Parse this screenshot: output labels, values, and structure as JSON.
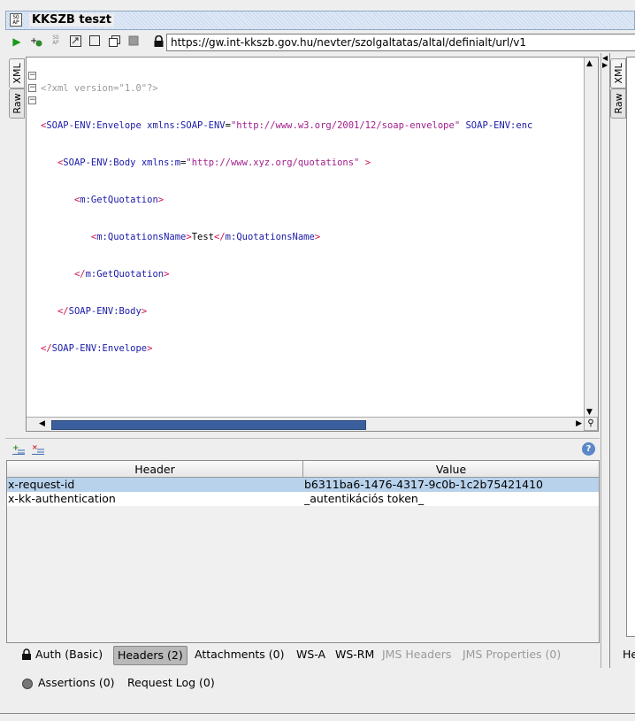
{
  "window": {
    "title": "KKSZB teszt",
    "logo_text": "SO AP"
  },
  "toolbar": {
    "url": "https://gw.int-kkszb.gov.hu/nevter/szolgaltatas/altal/definialt/url/v1",
    "icons": [
      "run-icon",
      "add-endpoint-icon",
      "soap-icon",
      "format-icon",
      "split-view-icon",
      "tab-view-icon",
      "stop-icon",
      "lock-icon"
    ]
  },
  "side_tabs": {
    "xml": "XML",
    "raw": "Raw"
  },
  "editor": {
    "pi": "<?xml version=\"1.0\"?>",
    "lines": {
      "l2_tag": "SOAP-ENV:Envelope",
      "l2_attr1": "xmlns:SOAP-ENV",
      "l2_val1": "\"http://www.w3.org/2001/12/soap-envelope\"",
      "l2_attr2": "SOAP-ENV:enc",
      "l3_tag": "SOAP-ENV:Body",
      "l3_attr": "xmlns:m",
      "l3_val": "\"http://www.xyz.org/quotations\"",
      "l4_tag": "m:GetQuotation",
      "l5_tag": "m:QuotationsName",
      "l5_text": "Test",
      "l6_tag": "m:GetQuotation",
      "l7_tag": "SOAP-ENV:Body",
      "l8_tag": "SOAP-ENV:Envelope"
    }
  },
  "headers": {
    "columns": [
      "Header",
      "Value"
    ],
    "rows": [
      {
        "header": "x-request-id",
        "value": "b6311ba6-1476-4317-9c0b-1c2b75421410"
      },
      {
        "header": "x-kk-authentication",
        "value": "_autentikációs token_"
      }
    ]
  },
  "request_tabs": {
    "auth": "Auth (Basic)",
    "headers": "Headers (2)",
    "attachments": "Attachments (0)",
    "wsa": "WS-A",
    "wsrm": "WS-RM",
    "jms_headers": "JMS Headers",
    "jms_properties": "JMS Properties (0)",
    "right_cut": "He"
  },
  "bottom": {
    "assertions": "Assertions (0)",
    "request_log": "Request Log (0)"
  },
  "colors": {
    "selection": "#b8d2ec",
    "scroll_thumb": "#3b5f9c",
    "tag": "#1a1aa8",
    "bracket": "#d0104a",
    "value": "#a01e8c"
  }
}
